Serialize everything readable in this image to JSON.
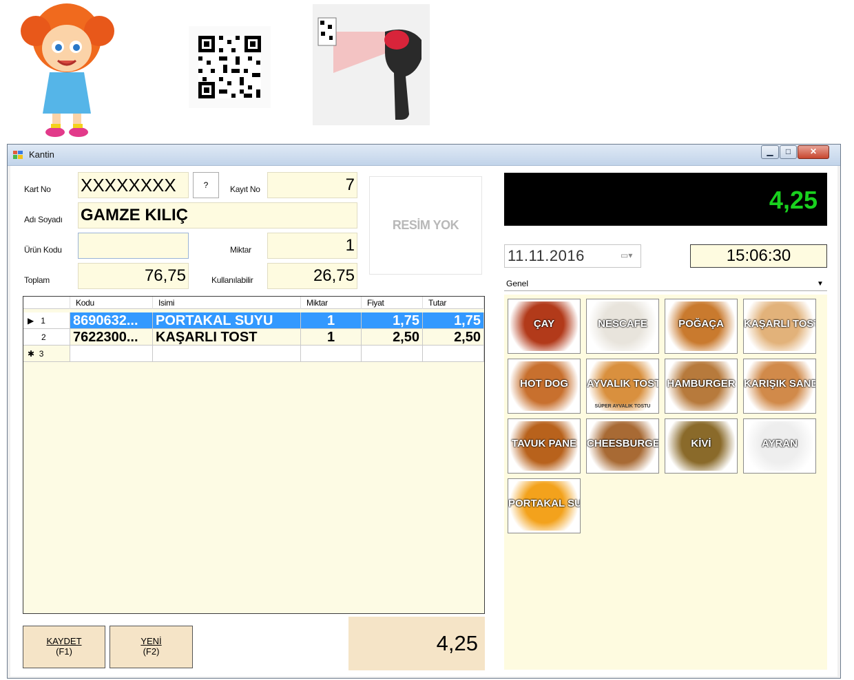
{
  "window": {
    "title": "Kantin"
  },
  "form": {
    "kart_no_label": "Kart No",
    "kart_no_value": "XXXXXXXX",
    "help_button": "?",
    "kayit_no_label": "Kayıt No",
    "kayit_no_value": "7",
    "ad_soyadi_label": "Adı Soyadı",
    "ad_soyadi_value": "GAMZE KILIÇ",
    "urun_kodu_label": "Ürün Kodu",
    "urun_kodu_value": "",
    "miktar_label": "Miktar",
    "miktar_value": "1",
    "toplam_label": "Toplam",
    "toplam_value": "76,75",
    "kullanilabilir_label": "Kullanılabilir",
    "kullanilabilir_value": "26,75",
    "photo_placeholder": "RESİM YOK"
  },
  "grid": {
    "columns": [
      "Kodu",
      "Isimi",
      "Miktar",
      "Fiyat",
      "Tutar"
    ],
    "rows": [
      {
        "row_num": "1",
        "marker": "▶",
        "kodu": "8690632...",
        "ismi": "PORTAKAL SUYU",
        "miktar": "1",
        "fiyat": "1,75",
        "tutar": "1,75"
      },
      {
        "row_num": "2",
        "marker": "",
        "kodu": "7622300...",
        "ismi": "KAŞARLI TOST",
        "miktar": "1",
        "fiyat": "2,50",
        "tutar": "2,50"
      },
      {
        "row_num": "3",
        "marker": "✱",
        "kodu": "",
        "ismi": "",
        "miktar": "",
        "fiyat": "",
        "tutar": ""
      }
    ]
  },
  "buttons": {
    "kaydet_line1": "KAYDET",
    "kaydet_line2": "(F1)",
    "yeni_line1": "YENİ",
    "yeni_line2": "(F2)"
  },
  "total": "4,25",
  "display_total": "4,25",
  "date": "11.11.2016",
  "time": "15:06:30",
  "category": "Genel",
  "products": [
    {
      "label": "ÇAY",
      "sub": "",
      "color": "#b23a1a"
    },
    {
      "label": "NESCAFE",
      "sub": "",
      "color": "#e8e4dc"
    },
    {
      "label": "POĞAÇA",
      "sub": "",
      "color": "#c97a2e"
    },
    {
      "label": "KAŞARLI TOST",
      "sub": "",
      "color": "#e2b27a"
    },
    {
      "label": "HOT DOG",
      "sub": "",
      "color": "#c8702e"
    },
    {
      "label": "AYVALIK TOSTU",
      "sub": "SÜPER AYVALIK TOSTU",
      "color": "#d9903e"
    },
    {
      "label": "HAMBURGER",
      "sub": "",
      "color": "#b77a3c"
    },
    {
      "label": "KARIŞIK SANDVİÇ",
      "sub": "",
      "color": "#d18a4a"
    },
    {
      "label": "TAVUK PANE",
      "sub": "",
      "color": "#b8621c"
    },
    {
      "label": "CHEESBURGER",
      "sub": "",
      "color": "#a86a34"
    },
    {
      "label": "KİVİ",
      "sub": "",
      "color": "#8a6a2a"
    },
    {
      "label": "AYRAN",
      "sub": "",
      "color": "#eeeeee"
    },
    {
      "label": "PORTAKAL SUYU",
      "sub": "",
      "color": "#f3a21c"
    }
  ]
}
